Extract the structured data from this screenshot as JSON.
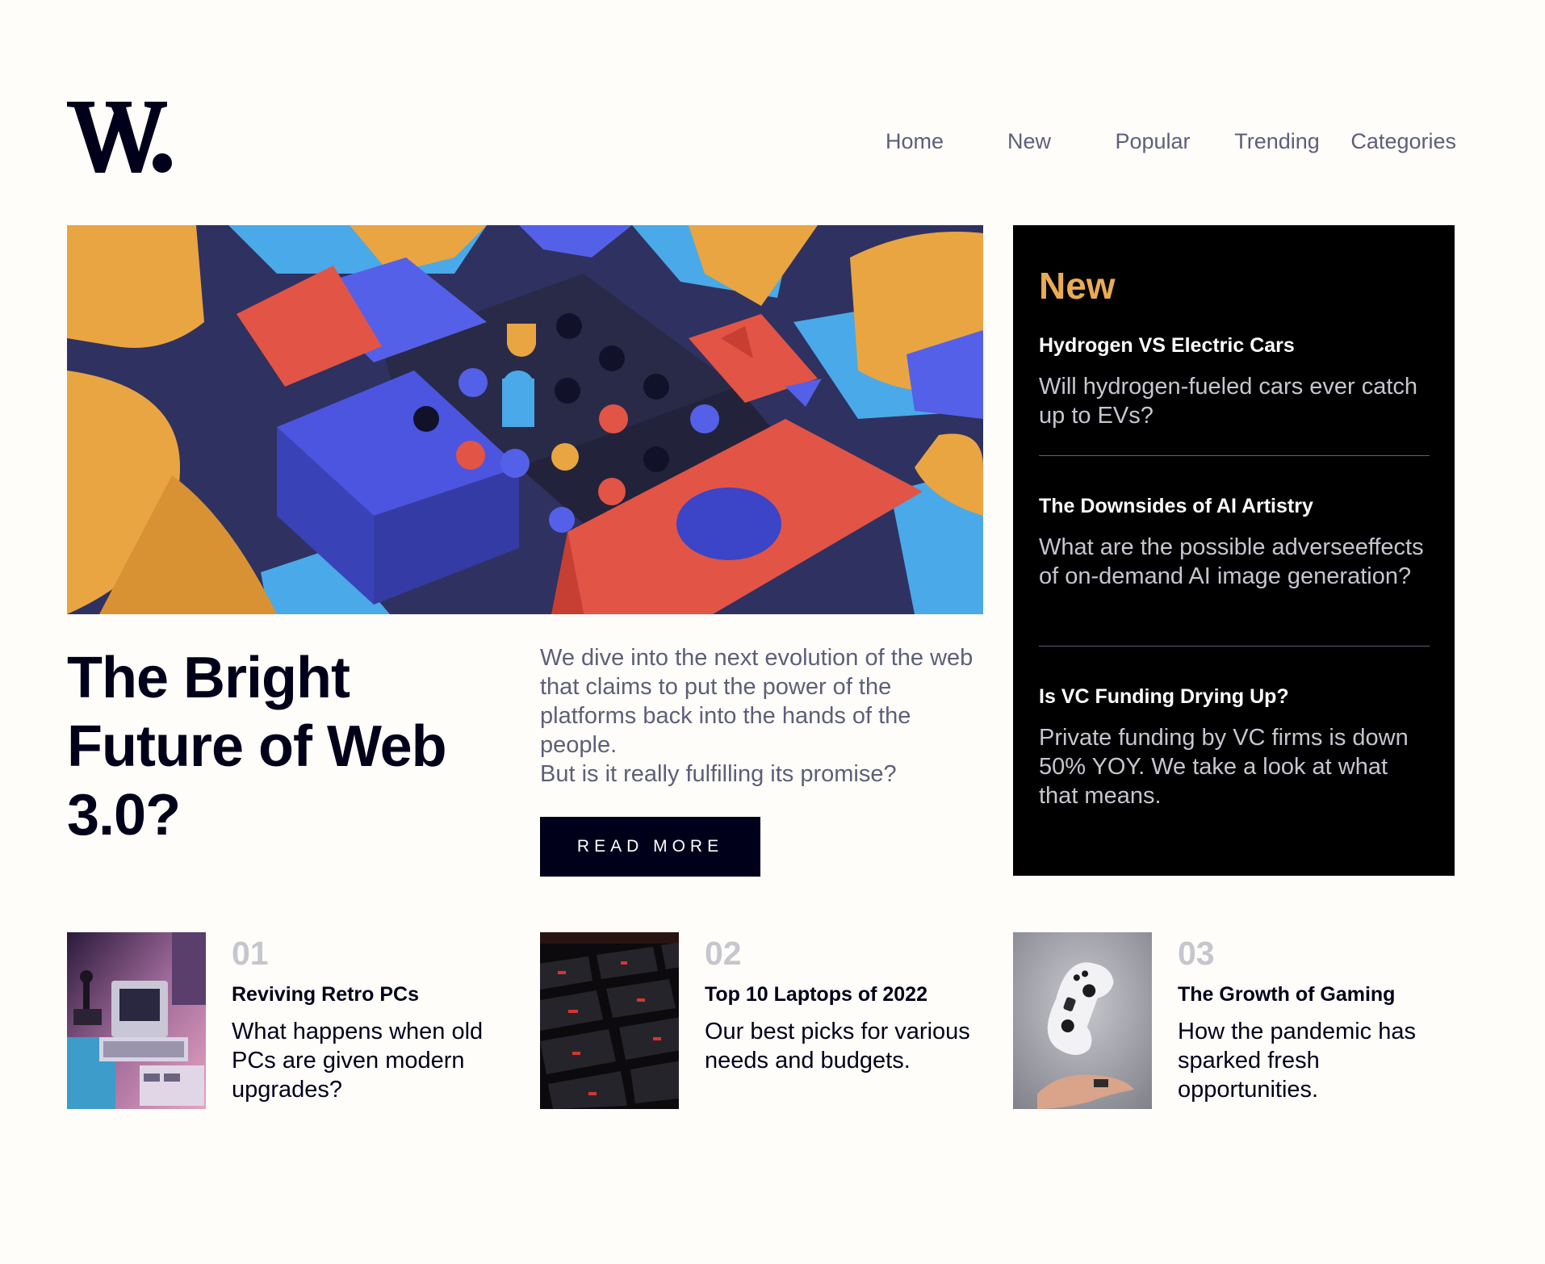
{
  "brand": {
    "logo_text": "W.",
    "colors": {
      "dark_navy": "#00001a",
      "accent_orange": "#e9ab53",
      "accent_red": "#f15e50",
      "grayish_blue": "#5d5f79",
      "grayish_light": "#c5c6ce",
      "background": "#fffdfa"
    }
  },
  "nav": {
    "items": [
      "Home",
      "New",
      "Popular",
      "Trending",
      "Categories"
    ]
  },
  "hero": {
    "image_icon": "abstract-blocks-image",
    "title": "The Bright Future of Web 3.0?",
    "description_line1": "We dive into the next evolution of the web that claims to put the power of the platforms back into the hands of the people.",
    "description_line2": "But is it really fulfilling its promise?",
    "cta_label": "READ MORE"
  },
  "new_panel": {
    "heading": "New",
    "items": [
      {
        "title": "Hydrogen VS Electric Cars",
        "description": "Will hydrogen-fueled cars ever catch up to EVs?"
      },
      {
        "title": "The Downsides of AI Artistry",
        "description": "What are the possible adverseeffects of on-demand AI image generation?"
      },
      {
        "title": "Is VC Funding Drying Up?",
        "description": "Private funding by VC firms is down 50% YOY. We take a look at what that means."
      }
    ]
  },
  "articles": [
    {
      "number": "01",
      "title": "Reviving Retro PCs",
      "description": "What happens when old PCs are given modern upgrades?",
      "image_icon": "retro-pc-image"
    },
    {
      "number": "02",
      "title": "Top 10 Laptops of 2022",
      "description": "Our best picks for various needs and budgets.",
      "image_icon": "keyboard-image"
    },
    {
      "number": "03",
      "title": "The Growth of Gaming",
      "description": "How the pandemic has sparked fresh opportunities.",
      "image_icon": "game-controller-image"
    }
  ]
}
